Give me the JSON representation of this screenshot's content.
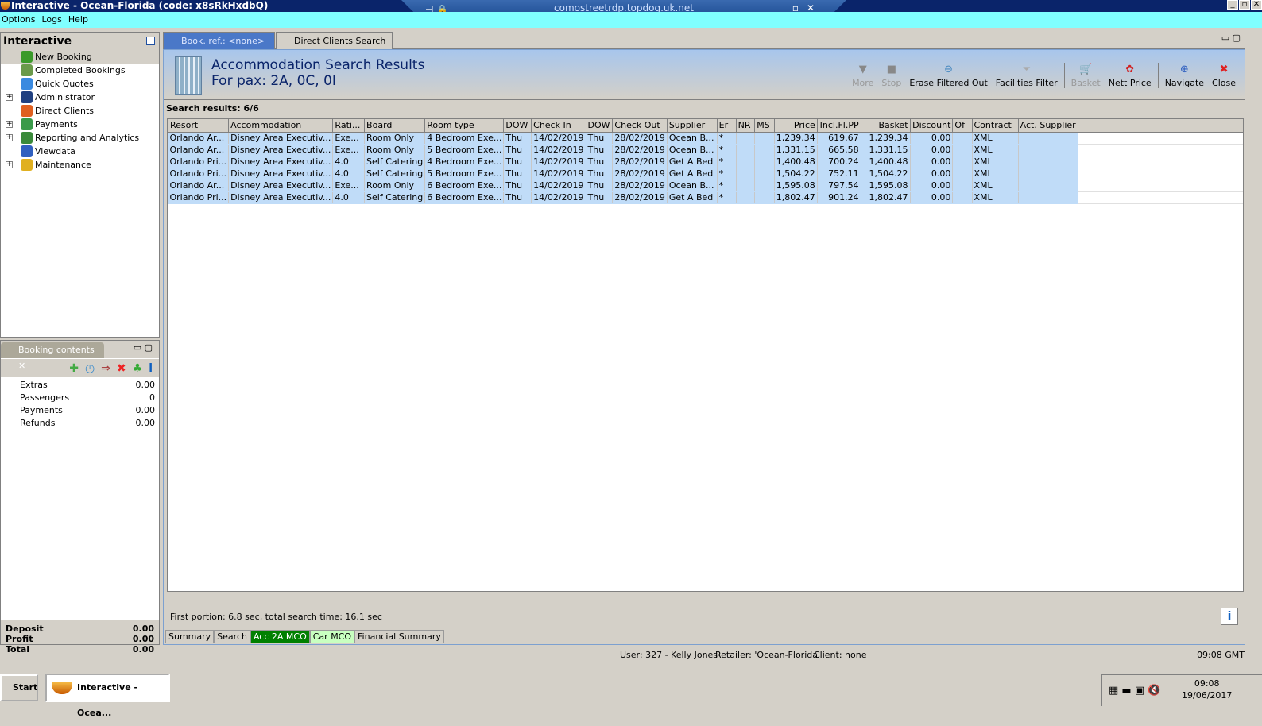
{
  "window": {
    "title": "Interactive - Ocean-Florida (code: x8sRkHxdbQ)",
    "rdp_host": "comostreetrdp.topdog.uk.net"
  },
  "menu": [
    "Options",
    "Logs",
    "Help"
  ],
  "nav": {
    "title": "Interactive",
    "items": [
      {
        "label": "New Booking",
        "expandable": false,
        "selected": true,
        "color": "#3a9a2a"
      },
      {
        "label": "Completed Bookings",
        "expandable": false,
        "color": "#6a9a4a"
      },
      {
        "label": "Quick Quotes",
        "expandable": false,
        "color": "#3a8ae0"
      },
      {
        "label": "Administrator",
        "expandable": true,
        "color": "#204080"
      },
      {
        "label": "Direct Clients",
        "expandable": false,
        "color": "#e06020"
      },
      {
        "label": "Payments",
        "expandable": true,
        "color": "#3a9a4a"
      },
      {
        "label": "Reporting and Analytics",
        "expandable": true,
        "color": "#3a8a3a"
      },
      {
        "label": "Viewdata",
        "expandable": false,
        "color": "#3060c0"
      },
      {
        "label": "Maintenance",
        "expandable": true,
        "color": "#e0b020"
      }
    ]
  },
  "booking_contents": {
    "title": "Booking contents",
    "rows": [
      {
        "label": "Extras",
        "value": "0.00"
      },
      {
        "label": "Passengers",
        "value": "0"
      },
      {
        "label": "Payments",
        "value": "0.00"
      },
      {
        "label": "Refunds",
        "value": "0.00"
      }
    ],
    "totals": [
      {
        "label": "Deposit",
        "value": "0.00"
      },
      {
        "label": "Profit",
        "value": "0.00"
      },
      {
        "label": "Total",
        "value": "0.00"
      }
    ]
  },
  "tabs": [
    {
      "label": "Book. ref.: <none>",
      "active": true
    },
    {
      "label": "Direct Clients Search",
      "active": false
    }
  ],
  "header": {
    "title": "Accommodation Search Results",
    "subtitle": "For pax: 2A, 0C, 0I"
  },
  "toolbar": [
    {
      "label": "More",
      "icon": "▼",
      "enabled": false
    },
    {
      "label": "Stop",
      "icon": "■",
      "enabled": false
    },
    {
      "label": "Erase Filtered Out",
      "icon": "⊖",
      "enabled": true
    },
    {
      "label": "Facilities Filter",
      "icon": "⏷",
      "enabled": true
    },
    {
      "label": "Basket",
      "icon": "🛒",
      "enabled": false,
      "sep": true
    },
    {
      "label": "Nett Price",
      "icon": "✿",
      "enabled": true
    },
    {
      "label": "Navigate",
      "icon": "⊕",
      "enabled": true,
      "sep": true
    },
    {
      "label": "Close",
      "icon": "✖",
      "enabled": true
    }
  ],
  "results": {
    "label": "Search results: 6/6",
    "columns": [
      "Resort",
      "Accommodation",
      "Rati...",
      "Board",
      "Room type",
      "DOW",
      "Check In",
      "DOW",
      "Check Out",
      "Supplier",
      "Er",
      "NR",
      "MS",
      "Price",
      "Incl.Fl.PP",
      "Basket",
      "Discount",
      "Of",
      "Contract",
      "Act. Supplier"
    ],
    "rows": [
      [
        "Orlando Ar...",
        "Disney Area Executiv...",
        "Exe...",
        "Room Only",
        "4 Bedroom Exe...",
        "Thu",
        "14/02/2019",
        "Thu",
        "28/02/2019",
        "Ocean B...",
        "*",
        "",
        "",
        "1,239.34",
        "619.67",
        "1,239.34",
        "0.00",
        "",
        "XML",
        ""
      ],
      [
        "Orlando Ar...",
        "Disney Area Executiv...",
        "Exe...",
        "Room Only",
        "5 Bedroom Exe...",
        "Thu",
        "14/02/2019",
        "Thu",
        "28/02/2019",
        "Ocean B...",
        "*",
        "",
        "",
        "1,331.15",
        "665.58",
        "1,331.15",
        "0.00",
        "",
        "XML",
        ""
      ],
      [
        "Orlando Pri...",
        "Disney Area Executiv...",
        "4.0",
        "Self Catering",
        "4 Bedroom Exe...",
        "Thu",
        "14/02/2019",
        "Thu",
        "28/02/2019",
        "Get A Bed",
        "*",
        "",
        "",
        "1,400.48",
        "700.24",
        "1,400.48",
        "0.00",
        "",
        "XML",
        ""
      ],
      [
        "Orlando Pri...",
        "Disney Area Executiv...",
        "4.0",
        "Self Catering",
        "5 Bedroom Exe...",
        "Thu",
        "14/02/2019",
        "Thu",
        "28/02/2019",
        "Get A Bed",
        "*",
        "",
        "",
        "1,504.22",
        "752.11",
        "1,504.22",
        "0.00",
        "",
        "XML",
        ""
      ],
      [
        "Orlando Ar...",
        "Disney Area Executiv...",
        "Exe...",
        "Room Only",
        "6 Bedroom Exe...",
        "Thu",
        "14/02/2019",
        "Thu",
        "28/02/2019",
        "Ocean B...",
        "*",
        "",
        "",
        "1,595.08",
        "797.54",
        "1,595.08",
        "0.00",
        "",
        "XML",
        ""
      ],
      [
        "Orlando Pri...",
        "Disney Area Executiv...",
        "4.0",
        "Self Catering",
        "6 Bedroom Exe...",
        "Thu",
        "14/02/2019",
        "Thu",
        "28/02/2019",
        "Get A Bed",
        "*",
        "",
        "",
        "1,802.47",
        "901.24",
        "1,802.47",
        "0.00",
        "",
        "XML",
        ""
      ]
    ]
  },
  "status": "First portion: 6.8 sec, total search time: 16.1 sec",
  "bottom_tabs": [
    {
      "label": "Summary",
      "bg": "#d4d0c8",
      "fg": "#000"
    },
    {
      "label": "Search",
      "bg": "#d4d0c8",
      "fg": "#000"
    },
    {
      "label": "Acc 2A MCO",
      "bg": "#008000",
      "fg": "#fff"
    },
    {
      "label": "Car MCO",
      "bg": "#c8ffc0",
      "fg": "#000"
    },
    {
      "label": "Financial Summary",
      "bg": "#d4d0c8",
      "fg": "#000"
    }
  ],
  "userbar": {
    "user": "User: 327 - Kelly Jones",
    "retailer": "Retailer: 'Ocean-Florida'",
    "client": "Client: none",
    "time": "09:08 GMT"
  },
  "taskbar": {
    "start": "Start",
    "task": "Interactive - Ocea...",
    "time": "09:08",
    "date": "19/06/2017"
  }
}
